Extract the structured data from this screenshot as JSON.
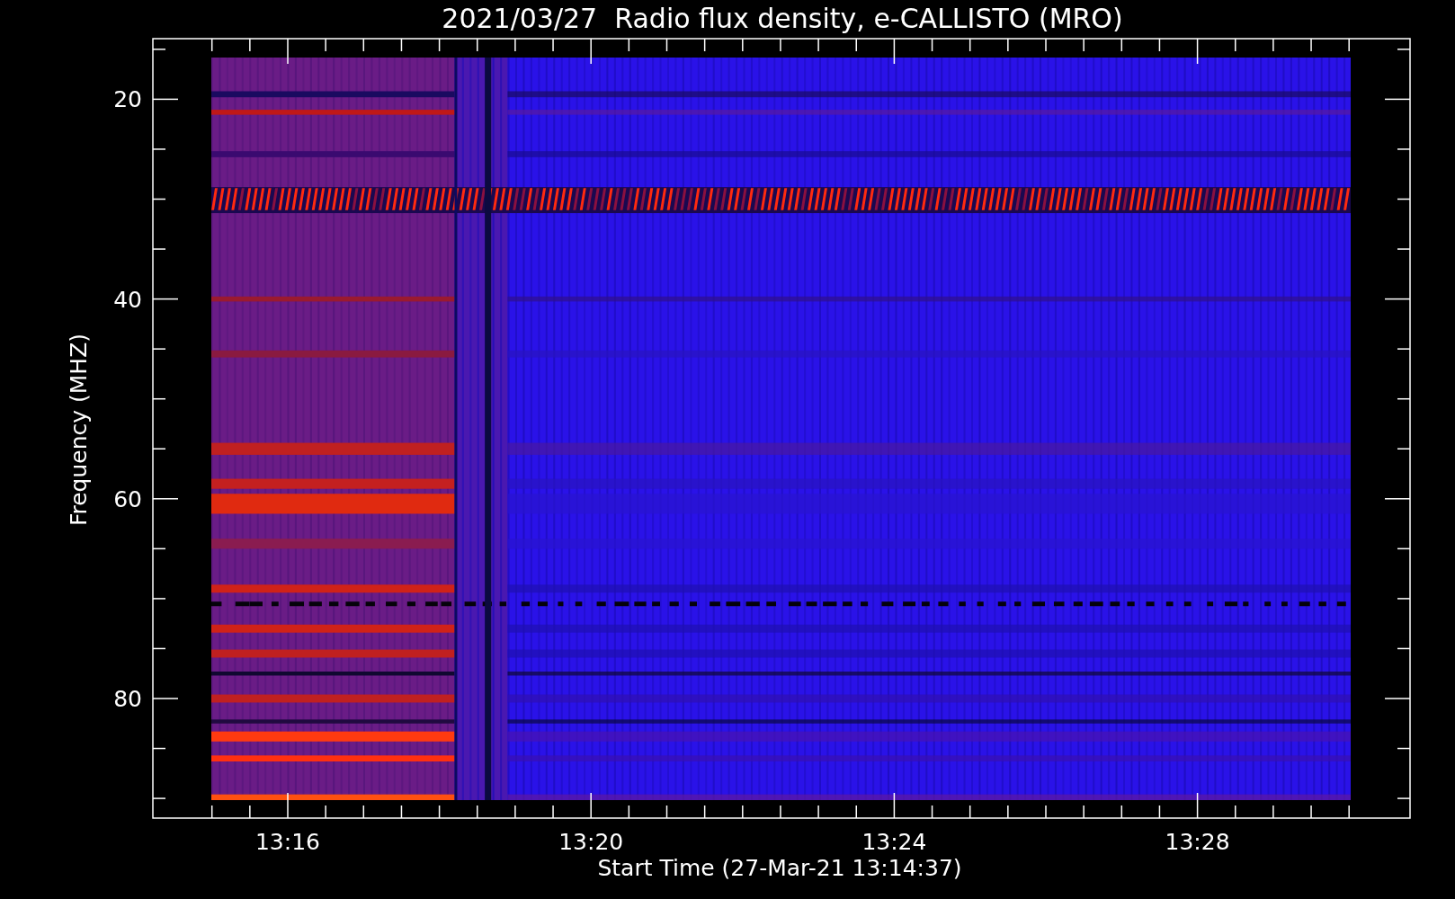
{
  "chart": {
    "title": "2021/03/27  Radio flux density, e-CALLISTO (MRO)",
    "y_axis": {
      "label": "Frequency (MHZ)",
      "ticks": [
        "20",
        "40",
        "60",
        "80"
      ]
    },
    "x_axis": {
      "label": "Start Time (27-Mar-21 13:14:37)",
      "ticks": [
        "13:16",
        "13:20",
        "13:24",
        "13:28"
      ]
    }
  }
}
